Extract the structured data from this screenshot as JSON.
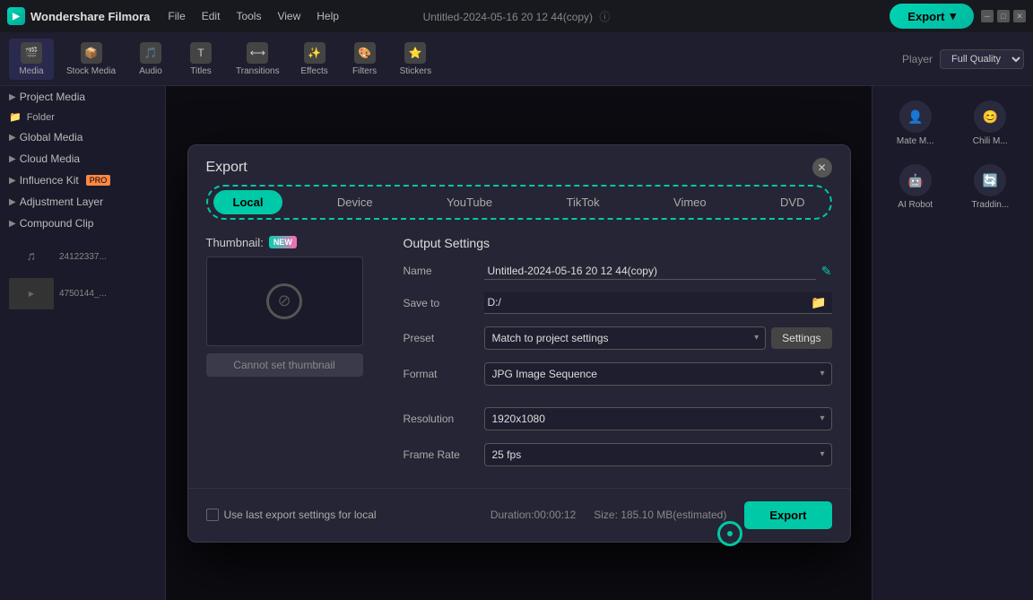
{
  "app": {
    "name": "Wondershare Filmora",
    "title_bar": "Untitled-2024-05-16 20 12 44(copy)"
  },
  "menu": {
    "items": [
      "File",
      "Edit",
      "Tools",
      "View",
      "Help"
    ]
  },
  "toolbar": {
    "tools": [
      {
        "id": "media",
        "label": "Media",
        "active": true
      },
      {
        "id": "stock",
        "label": "Stock Media"
      },
      {
        "id": "audio",
        "label": "Audio"
      },
      {
        "id": "titles",
        "label": "Titles"
      },
      {
        "id": "transitions",
        "label": "Transitions"
      },
      {
        "id": "effects",
        "label": "Effects"
      },
      {
        "id": "filters",
        "label": "Filters"
      },
      {
        "id": "stickers",
        "label": "Stickers"
      }
    ],
    "player_label": "Player",
    "quality_label": "Full Quality"
  },
  "right_panel": {
    "tools": [
      {
        "id": "mate",
        "label": "Mate M..."
      },
      {
        "id": "chili",
        "label": "Chili M..."
      },
      {
        "id": "ai_robot",
        "label": "AI Robot"
      },
      {
        "id": "traddin",
        "label": "Traddin..."
      }
    ]
  },
  "export_modal": {
    "title": "Export",
    "tabs": [
      "Local",
      "Device",
      "YouTube",
      "TikTok",
      "Vimeo",
      "DVD"
    ],
    "active_tab": "Local",
    "thumbnail": {
      "label": "Thumbnail:",
      "badge": "NEW",
      "cannot_set_label": "Cannot set thumbnail"
    },
    "output_settings": {
      "title": "Output Settings",
      "fields": {
        "name_label": "Name",
        "name_value": "Untitled-2024-05-16 20 12 44(copy)",
        "save_to_label": "Save to",
        "save_to_value": "D:/",
        "preset_label": "Preset",
        "preset_value": "Match to project settings",
        "settings_btn": "Settings",
        "format_label": "Format",
        "format_value": "JPG Image Sequence",
        "resolution_label": "Resolution",
        "resolution_value": "1920x1080",
        "frame_rate_label": "Frame Rate",
        "frame_rate_value": "25 fps"
      }
    },
    "footer": {
      "checkbox_label": "Use last export settings for local",
      "duration_label": "Duration:00:00:12",
      "size_label": "Size: 185.10 MB(estimated)",
      "export_btn": "Export"
    }
  },
  "colors": {
    "accent": "#00c9a7",
    "bg_dark": "#1a1a2a",
    "bg_mid": "#252535",
    "border": "#3a3a4a"
  }
}
